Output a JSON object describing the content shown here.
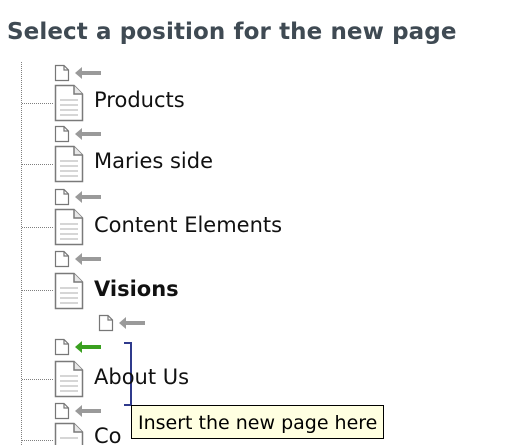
{
  "heading": "Select a position for the new page",
  "items": [
    {
      "label": "Products"
    },
    {
      "label": "Maries side"
    },
    {
      "label": "Content Elements"
    },
    {
      "label": "Visions",
      "bold": true
    },
    {
      "label": "About Us"
    },
    {
      "label": "Co"
    }
  ],
  "tooltip": "Insert the new page here",
  "colors": {
    "heading": "#3f4a53",
    "arrow_default": "#9a9a9a",
    "arrow_active": "#3aa020",
    "tooltip_bg": "#ffffe1"
  },
  "icons": {
    "page": "page-icon",
    "insert_arrow": "left-arrow-icon"
  }
}
